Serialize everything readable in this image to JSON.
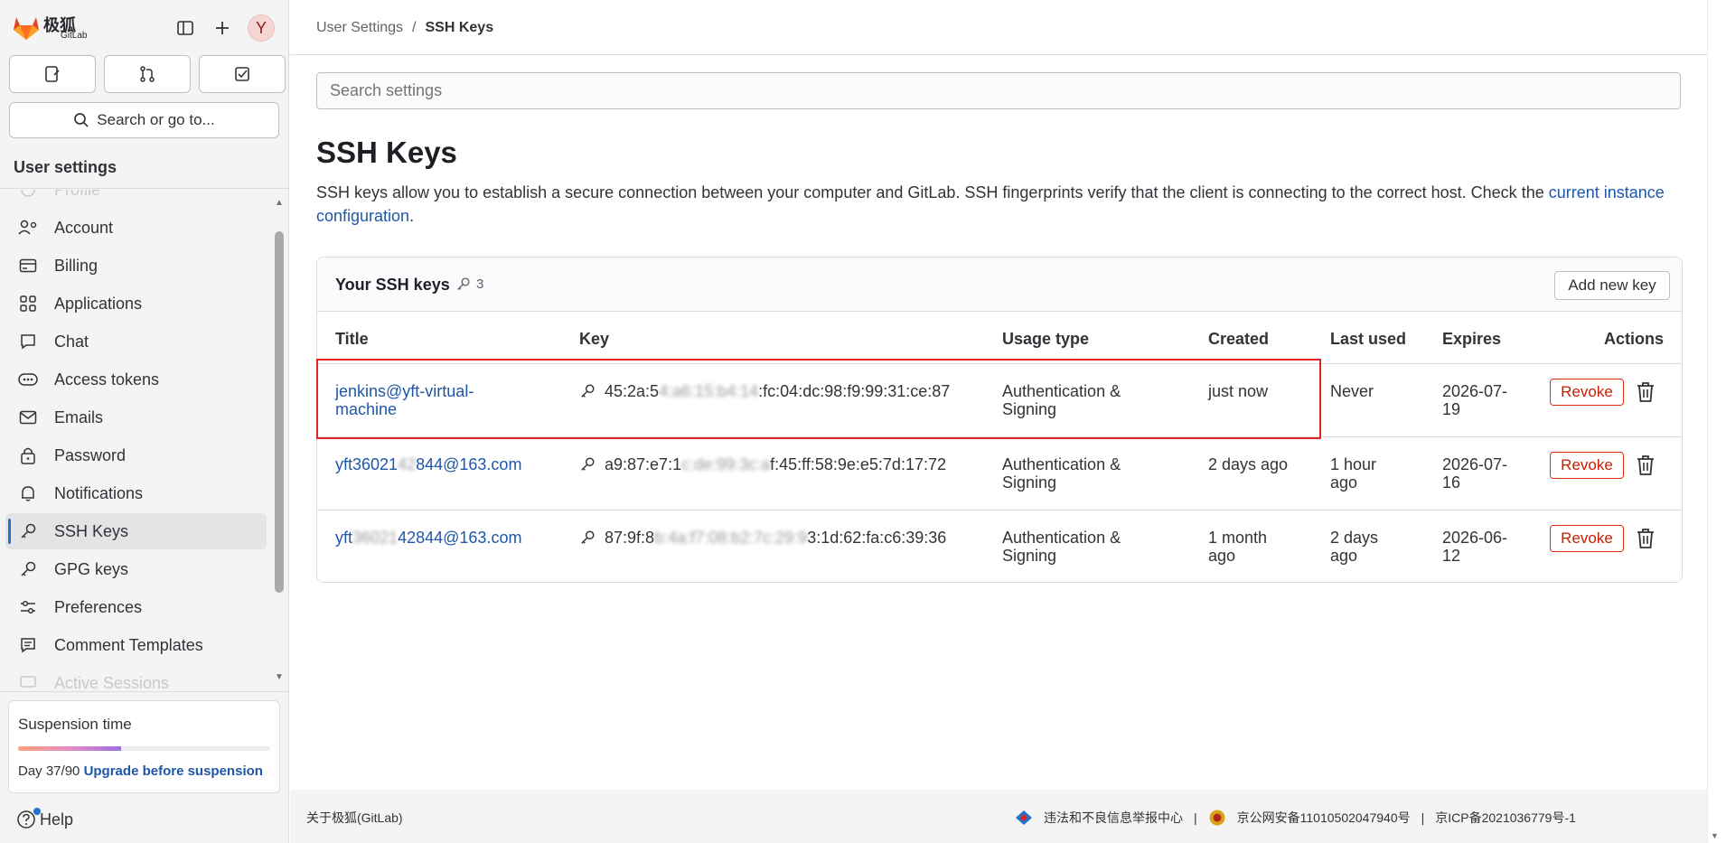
{
  "brand": {
    "name_cn": "极狐",
    "name_en": "GitLab"
  },
  "header": {
    "avatar_letter": "Y"
  },
  "sidebar": {
    "search_label": "Search or go to...",
    "section_title": "User settings",
    "items": [
      {
        "label": "Profile",
        "icon": "profile-icon"
      },
      {
        "label": "Account",
        "icon": "account-icon"
      },
      {
        "label": "Billing",
        "icon": "billing-icon"
      },
      {
        "label": "Applications",
        "icon": "applications-icon"
      },
      {
        "label": "Chat",
        "icon": "chat-icon"
      },
      {
        "label": "Access tokens",
        "icon": "token-icon"
      },
      {
        "label": "Emails",
        "icon": "mail-icon"
      },
      {
        "label": "Password",
        "icon": "lock-icon"
      },
      {
        "label": "Notifications",
        "icon": "bell-icon"
      },
      {
        "label": "SSH Keys",
        "icon": "key-icon"
      },
      {
        "label": "GPG keys",
        "icon": "key-icon"
      },
      {
        "label": "Preferences",
        "icon": "preferences-icon"
      },
      {
        "label": "Comment Templates",
        "icon": "comment-icon"
      },
      {
        "label": "Active Sessions",
        "icon": "session-icon"
      }
    ],
    "suspension": {
      "title": "Suspension time",
      "progress": 0.41,
      "day_text": "Day 37/90",
      "upgrade_link": "Upgrade before suspension"
    },
    "help_label": "Help"
  },
  "breadcrumb": {
    "parent": "User Settings",
    "separator": "/",
    "current": "SSH Keys"
  },
  "search_settings": {
    "placeholder": "Search settings"
  },
  "page": {
    "title": "SSH Keys",
    "description": "SSH keys allow you to establish a secure connection between your computer and GitLab. SSH fingerprints verify that the client is connecting to the correct host. Check the ",
    "description_link": "current instance configuration",
    "description_end": "."
  },
  "keys_card": {
    "title": "Your SSH keys",
    "count": "3",
    "add_button": "Add new key",
    "columns": [
      "Title",
      "Key",
      "Usage type",
      "Created",
      "Last used",
      "Expires",
      "Actions"
    ],
    "rows": [
      {
        "title_line1": "jenkins@yft-virtual-",
        "title_line2": "machine",
        "key_a": "45:2a:5",
        "key_b": "4:a6:15:b4:14",
        "key_c": ":fc:04:dc:98:f9:99:31:ce:87",
        "usage_line1": "Authentication &",
        "usage_line2": "Signing",
        "created": "just now",
        "last_used": "Never",
        "expires_line1": "2026-07-",
        "expires_line2": "19",
        "revoke": "Revoke"
      },
      {
        "title_a": "yft36021",
        "title_b": "42",
        "title_c": "844@163.com",
        "key_a": "a9:87:e7:1",
        "key_b": "c:de:99:3c:a",
        "key_c": "f:45:ff:58:9e:e5:7d:17:72",
        "usage_line1": "Authentication &",
        "usage_line2": "Signing",
        "created": "2 days ago",
        "last_used_line1": "1 hour",
        "last_used_line2": "ago",
        "expires_line1": "2026-07-",
        "expires_line2": "16",
        "revoke": "Revoke"
      },
      {
        "title_a": "yft",
        "title_b": "36021",
        "title_c": "42844@163.com",
        "key_a": "87:9f:8",
        "key_b": "b:4a:f7:08:b2:7c:29:9",
        "key_c": "3:1d:62:fa:c6:39:36",
        "usage_line1": "Authentication &",
        "usage_line2": "Signing",
        "created_line1": "1 month",
        "created_line2": "ago",
        "last_used_line1": "2 days",
        "last_used_line2": "ago",
        "expires_line1": "2026-06-",
        "expires_line2": "12",
        "revoke": "Revoke"
      }
    ]
  },
  "footer": {
    "about": "关于极狐(GitLab)",
    "report": "违法和不良信息举报中心",
    "sep": "|",
    "police": "京公网安备11010502047940号",
    "icp": "京ICP备2021036779号-1"
  },
  "colors": {
    "link": "#1f57a8",
    "danger": "#dd2b0e",
    "highlight": "#e02424",
    "active_indicator": "#1f75cb"
  }
}
